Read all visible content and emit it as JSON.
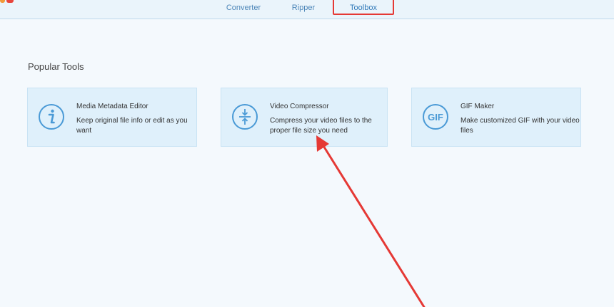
{
  "tabs": [
    {
      "label": "Converter"
    },
    {
      "label": "Ripper"
    },
    {
      "label": "Toolbox",
      "active": true
    }
  ],
  "section": {
    "title": "Popular Tools"
  },
  "tools": [
    {
      "name": "Media Metadata Editor",
      "description": "Keep original file info or edit as you want",
      "icon": "info-icon"
    },
    {
      "name": "Video Compressor",
      "description": "Compress your video files to the proper file size you need",
      "icon": "compress-icon"
    },
    {
      "name": "GIF Maker",
      "description": "Make customized GIF with your video files",
      "icon": "gif-icon",
      "icon_text": "GIF"
    }
  ],
  "colors": {
    "accent": "#3d8fd6",
    "card_background": "#dff0fb",
    "annotation": "#e53935"
  }
}
